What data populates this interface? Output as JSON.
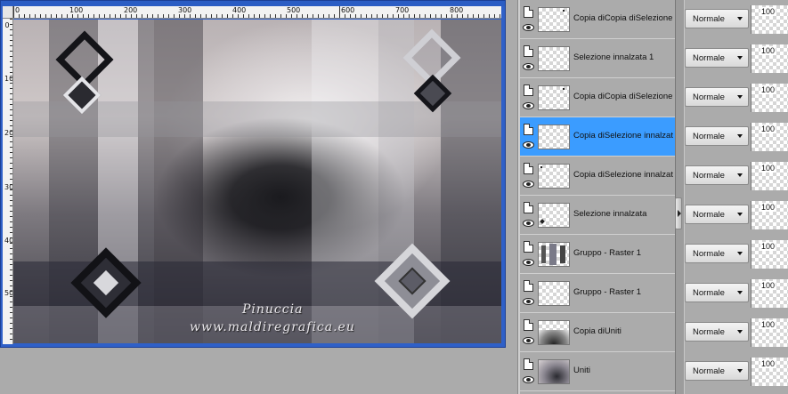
{
  "rulers": {
    "h_labels": [
      "0",
      "100",
      "200",
      "300",
      "400",
      "500",
      "600",
      "700",
      "800"
    ],
    "v_labels": [
      "0",
      "100",
      "200",
      "300",
      "400",
      "500"
    ]
  },
  "artwork": {
    "watermark_line1": "Pinuccia",
    "watermark_line2": "www.maldiregrafica.eu"
  },
  "layers": [
    {
      "name": "Copia diCopia diSelezione ir",
      "blend": "Normale",
      "opacity": "100",
      "selected": false
    },
    {
      "name": "Selezione innalzata 1",
      "blend": "Normale",
      "opacity": "100",
      "selected": false
    },
    {
      "name": "Copia diCopia diSelezione ir",
      "blend": "Normale",
      "opacity": "100",
      "selected": false
    },
    {
      "name": "Copia diSelezione innalzata",
      "blend": "Normale",
      "opacity": "100",
      "selected": true
    },
    {
      "name": "Copia diSelezione innalzata",
      "blend": "Normale",
      "opacity": "100",
      "selected": false
    },
    {
      "name": "Selezione innalzata",
      "blend": "Normale",
      "opacity": "100",
      "selected": false
    },
    {
      "name": "Gruppo - Raster 1",
      "blend": "Normale",
      "opacity": "100",
      "selected": false
    },
    {
      "name": "Gruppo - Raster 1",
      "blend": "Normale",
      "opacity": "100",
      "selected": false
    },
    {
      "name": "Copia diUniti",
      "blend": "Normale",
      "opacity": "100",
      "selected": false
    },
    {
      "name": "Uniti",
      "blend": "Normale",
      "opacity": "100",
      "selected": false
    }
  ],
  "colors": {
    "selection": "#3b9cff",
    "window_frame": "#2f60c8"
  }
}
